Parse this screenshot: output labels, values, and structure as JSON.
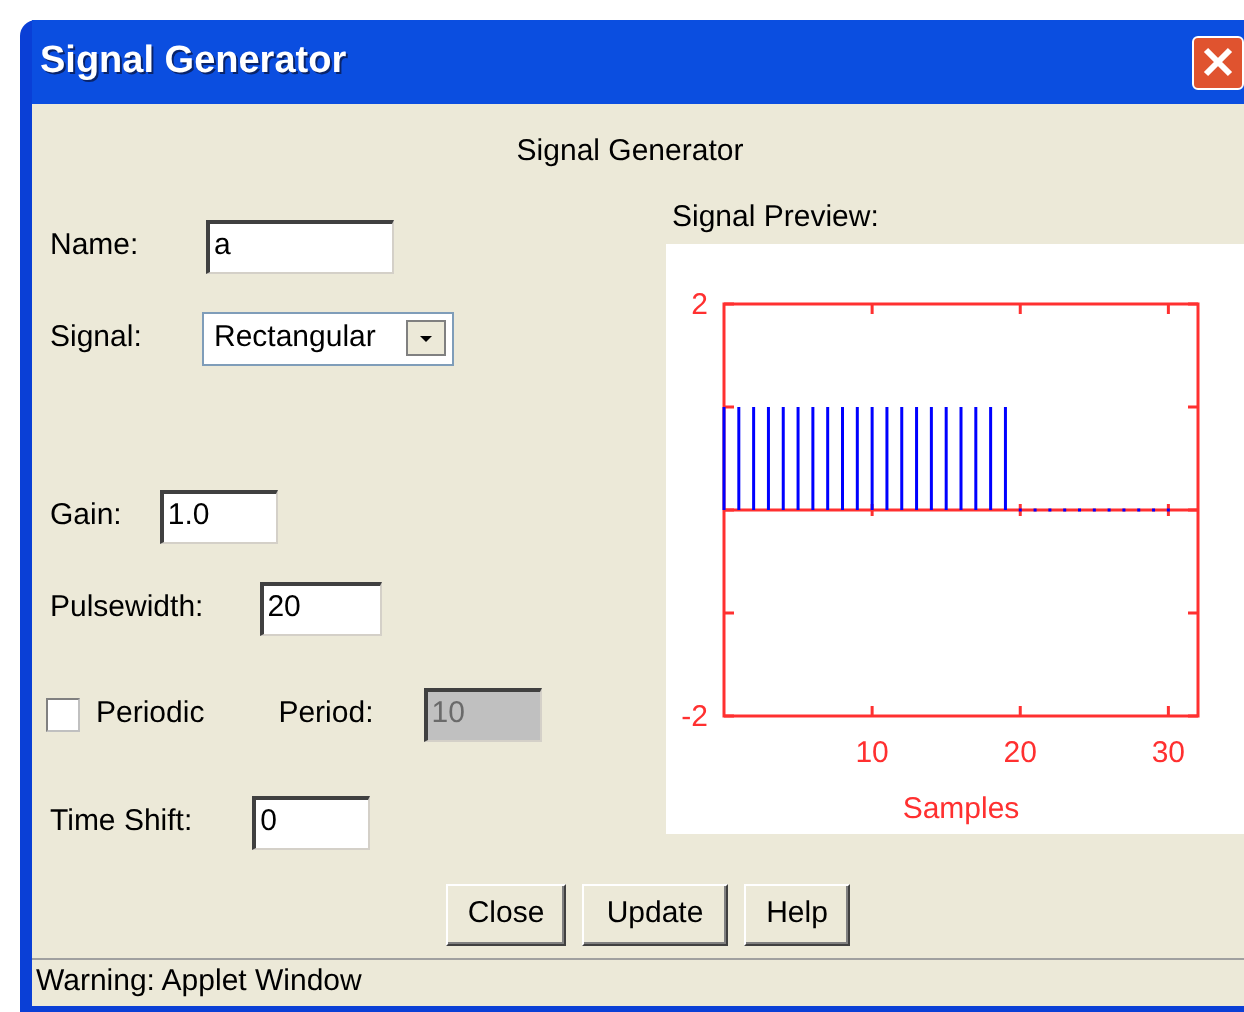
{
  "window": {
    "title": "Signal Generator"
  },
  "heading": "Signal Generator",
  "form": {
    "name": {
      "label": "Name:",
      "value": "a"
    },
    "signal": {
      "label": "Signal:",
      "value": "Rectangular"
    },
    "gain": {
      "label": "Gain:",
      "value": "1.0"
    },
    "pulsewidth": {
      "label": "Pulsewidth:",
      "value": "20"
    },
    "periodic": {
      "label": "Periodic",
      "checked": false
    },
    "period": {
      "label": "Period:",
      "value": "10",
      "disabled": true
    },
    "time_shift": {
      "label": "Time Shift:",
      "value": "0"
    }
  },
  "preview": {
    "label": "Signal Preview:",
    "chart_data": {
      "type": "bar",
      "xlabel": "Samples",
      "x": [
        0,
        1,
        2,
        3,
        4,
        5,
        6,
        7,
        8,
        9,
        10,
        11,
        12,
        13,
        14,
        15,
        16,
        17,
        18,
        19,
        20,
        21,
        22,
        23,
        24,
        25,
        26,
        27,
        28,
        29,
        30
      ],
      "series": [
        {
          "color": "#0000ff",
          "values": [
            1,
            1,
            1,
            1,
            1,
            1,
            1,
            1,
            1,
            1,
            1,
            1,
            1,
            1,
            1,
            1,
            1,
            1,
            1,
            1,
            0,
            0,
            0,
            0,
            0,
            0,
            0,
            0,
            0,
            0,
            0
          ]
        }
      ],
      "ref_lines": [
        {
          "axis": "y",
          "value": 0
        }
      ],
      "xlim": [
        0,
        32
      ],
      "ylim": [
        -2,
        2
      ],
      "xticks": [
        10,
        20,
        30
      ],
      "yticks": [
        -2,
        2
      ]
    }
  },
  "buttons": [
    "Close",
    "Update",
    "Help"
  ],
  "status_bar": "Warning: Applet Window"
}
